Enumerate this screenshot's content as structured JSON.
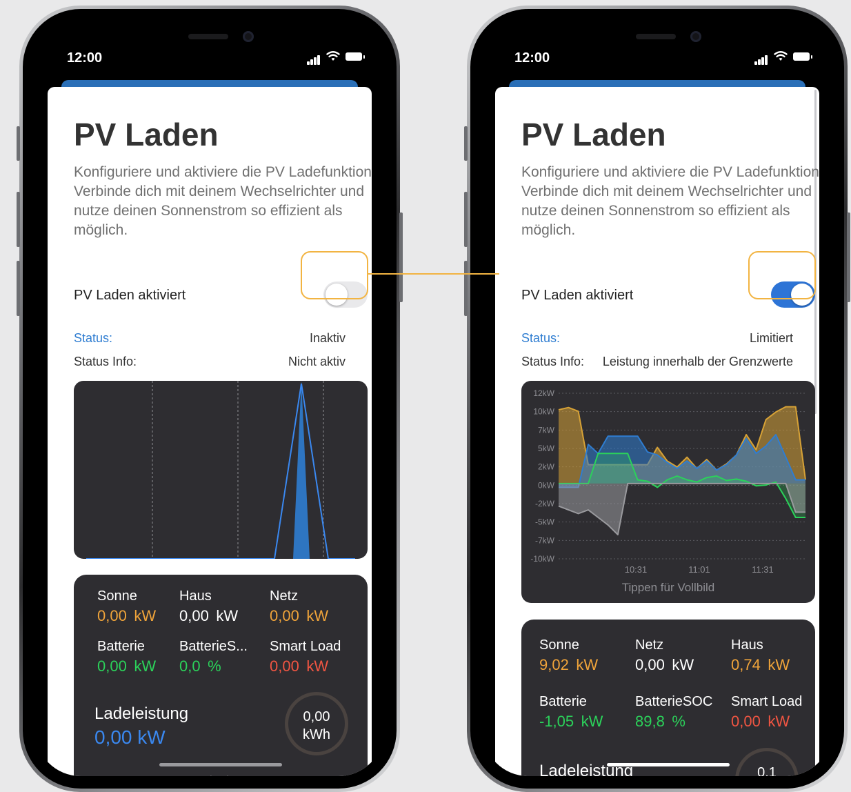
{
  "colors": {
    "accent_blue": "#2f7dd1",
    "toggle_on": "#2d74d6",
    "toggle_off": "#e9e9eb",
    "highlight": "#f2b442",
    "sun_orange": "#f0a43a",
    "battery_green": "#2bd25a",
    "smartload_red": "#f05542",
    "ladeleistung_blue": "#3a88f0",
    "card_bg": "#2e2d31"
  },
  "left_phone": {
    "time": "12:00",
    "title": "PV Laden",
    "description": "Konfiguriere und aktiviere die PV Ladefunktion. Verbinde dich mit deinem Wechselrichter und nutze deinen Sonnenstrom so effizient als möglich.",
    "toggle_label": "PV Laden aktiviert",
    "toggle_on": false,
    "status_label": "Status:",
    "status_value": "Inaktiv",
    "status_info_label": "Status Info:",
    "status_info_value": "Nicht aktiv",
    "metrics": [
      {
        "label": "Sonne",
        "value": "0,00",
        "unit": "kW",
        "color": "orange"
      },
      {
        "label": "Haus",
        "value": "0,00",
        "unit": "kW",
        "color": "white"
      },
      {
        "label": "Netz",
        "value": "0,00",
        "unit": "kW",
        "color": "orange"
      },
      {
        "label": "Batterie",
        "value": "0,00",
        "unit": "kW",
        "color": "green"
      },
      {
        "label": "BatterieS...",
        "value": "0,0",
        "unit": "%",
        "color": "green"
      },
      {
        "label": "Smart Load",
        "value": "0,00",
        "unit": "kW",
        "color": "red"
      }
    ],
    "ladeleistung_label": "Ladeleistung",
    "ladeleistung_value": "0,00 kW",
    "energy_value": "0,00",
    "energy_unit": "kWh",
    "expand_icon": "chevron-down-icon"
  },
  "right_phone": {
    "time": "12:00",
    "title": "PV Laden",
    "description": "Konfiguriere und aktiviere die PV Ladefunktion. Verbinde dich mit deinem Wechselrichter und nutze deinen Sonnenstrom so effizient als möglich.",
    "toggle_label": "PV Laden aktiviert",
    "toggle_on": true,
    "status_label": "Status:",
    "status_value": "Limitiert",
    "status_info_label": "Status Info:",
    "status_info_value": "Leistung innerhalb der Grenzwerte",
    "chart_hint": "Tippen für Vollbild",
    "metrics": [
      {
        "label": "Sonne",
        "value": "9,02",
        "unit": "kW",
        "color": "orange"
      },
      {
        "label": "Netz",
        "value": "0,00",
        "unit": "kW",
        "color": "white"
      },
      {
        "label": "Haus",
        "value": "0,74",
        "unit": "kW",
        "color": "orange"
      },
      {
        "label": "Batterie",
        "value": "-1,05",
        "unit": "kW",
        "color": "green"
      },
      {
        "label": "BatterieSOC",
        "value": "89,8",
        "unit": "%",
        "color": "green"
      },
      {
        "label": "Smart Load",
        "value": "0,00",
        "unit": "kW",
        "color": "red"
      }
    ],
    "ladeleistung_label": "Ladeleistung",
    "ring_value": "0,1"
  },
  "chart_data": [
    {
      "type": "line",
      "title": "",
      "xlabel": "",
      "ylabel": "",
      "x": [
        0,
        1,
        2,
        3,
        4,
        5,
        6,
        7,
        8,
        9,
        10
      ],
      "series": [
        {
          "values": [
            0,
            0,
            0,
            0,
            0,
            0,
            0,
            0,
            1,
            0,
            0
          ]
        }
      ],
      "grid": "vertical dashed"
    },
    {
      "type": "area",
      "title": "",
      "xlabel": "",
      "ylabel": "",
      "ytick_labels": [
        "12kW",
        "10kW",
        "7kW",
        "5kW",
        "2kW",
        "0kW",
        "-2kW",
        "-5kW",
        "-7kW",
        "-10kW"
      ],
      "ylim": [
        -10,
        12
      ],
      "xtick_labels": [
        "10:31",
        "11:01",
        "11:31"
      ],
      "series": [
        {
          "color": "#d7a236",
          "values": [
            9.8,
            10.1,
            9.6,
            2.5,
            2.5,
            2.5,
            2.5,
            2.5,
            2.5,
            2.5,
            4.8,
            3.0,
            2.2,
            3.5,
            2.0,
            3.2,
            1.8,
            2.6,
            3.8,
            6.5,
            4.5,
            8.5,
            9.5,
            10.2,
            10.2,
            0.5
          ]
        },
        {
          "color": "#2f7dd1",
          "values": [
            -0.5,
            -0.5,
            -0.5,
            5.2,
            4.0,
            6.3,
            6.3,
            6.3,
            6.3,
            4.2,
            3.8,
            2.8,
            2.0,
            3.0,
            2.0,
            3.0,
            1.8,
            2.5,
            3.8,
            6.0,
            4.0,
            5.0,
            6.5,
            3.5,
            0.5,
            0.5
          ]
        },
        {
          "color": "#2bd25a",
          "values": [
            0.0,
            0.0,
            0.0,
            0.0,
            4.0,
            4.0,
            4.0,
            4.0,
            0.5,
            0.3,
            -0.5,
            0.5,
            1.0,
            0.5,
            0.2,
            0.8,
            1.0,
            0.4,
            0.6,
            0.3,
            -0.3,
            -0.2,
            0.2,
            -2.0,
            -4.5,
            -4.5
          ]
        },
        {
          "color": "#9a9a9e",
          "values": [
            -3.0,
            -3.5,
            -4.0,
            -3.5,
            -4.5,
            -5.5,
            -6.8,
            0,
            0,
            0,
            0,
            0,
            0,
            0,
            0,
            0,
            0,
            0,
            0,
            0,
            0,
            0,
            0,
            0,
            -3.8,
            -3.8
          ]
        }
      ],
      "grid": "dashed"
    }
  ]
}
